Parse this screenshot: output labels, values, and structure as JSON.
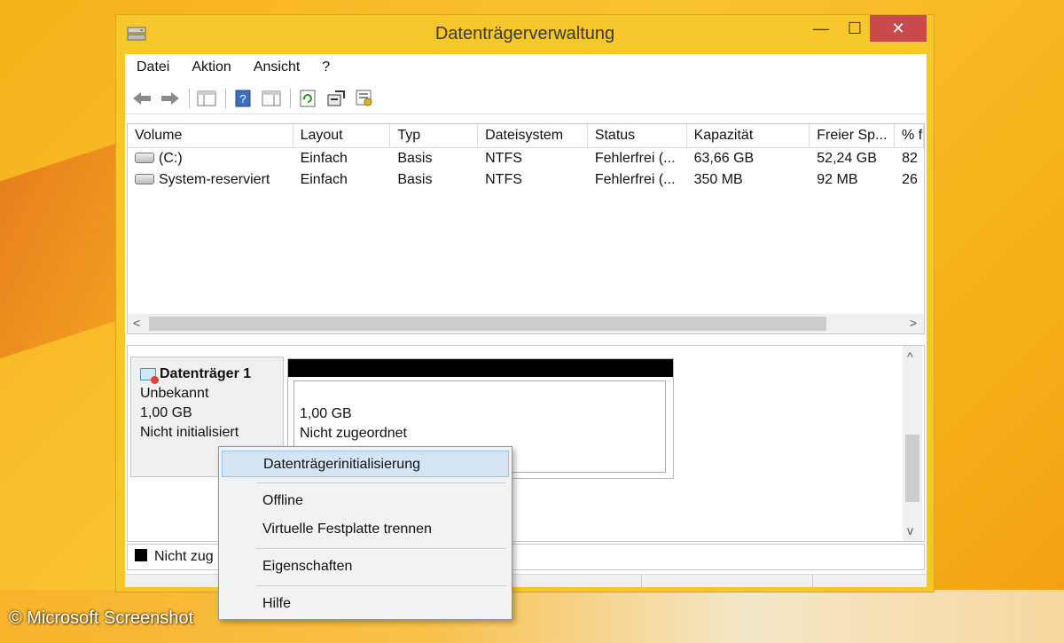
{
  "window": {
    "title": "Datenträgerverwaltung",
    "min": "—",
    "max": "☐",
    "close": "✕"
  },
  "menu": [
    "Datei",
    "Aktion",
    "Ansicht",
    "?"
  ],
  "volumes": {
    "columns": [
      "Volume",
      "Layout",
      "Typ",
      "Dateisystem",
      "Status",
      "Kapazität",
      "Freier Sp...",
      "% f"
    ],
    "rows": [
      [
        "(C:)",
        "Einfach",
        "Basis",
        "NTFS",
        "Fehlerfrei (...",
        "63,66 GB",
        "52,24 GB",
        "82"
      ],
      [
        "System-reserviert",
        "Einfach",
        "Basis",
        "NTFS",
        "Fehlerfrei (...",
        "350 MB",
        "92 MB",
        "26"
      ]
    ],
    "scroll_left": "<",
    "scroll_right": ">"
  },
  "disk": {
    "name": "Datenträger 1",
    "type": "Unbekannt",
    "size": "1,00 GB",
    "state": "Nicht initialisiert",
    "partition_size": "1,00 GB",
    "partition_state": "Nicht zugeordnet",
    "scroll_up": "^",
    "scroll_down": "v"
  },
  "legend": {
    "label": "Nicht zug"
  },
  "context_menu": {
    "items": [
      "Datenträgerinitialisierung",
      "Offline",
      "Virtuelle Festplatte trennen",
      "Eigenschaften",
      "Hilfe"
    ],
    "highlighted": 0
  },
  "watermark": "© Microsoft Screenshot",
  "colors": {
    "accent_highlight": "#d5e4f3",
    "close_button": "#c94a4a",
    "window_frame": "#f6c72a"
  }
}
